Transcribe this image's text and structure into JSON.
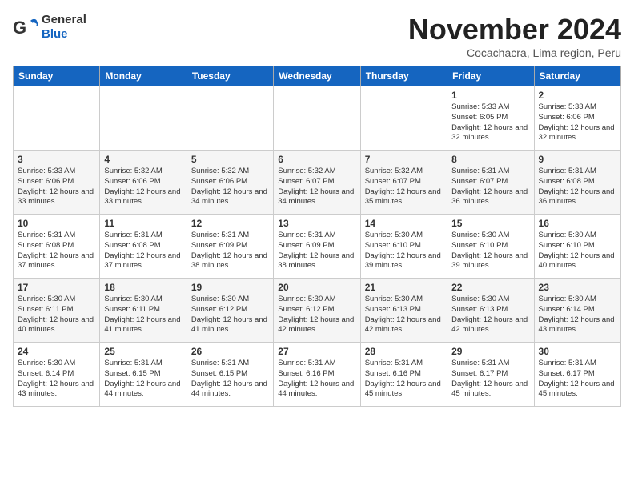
{
  "header": {
    "logo_line1": "General",
    "logo_line2": "Blue",
    "month": "November 2024",
    "location": "Cocachacra, Lima region, Peru"
  },
  "days_of_week": [
    "Sunday",
    "Monday",
    "Tuesday",
    "Wednesday",
    "Thursday",
    "Friday",
    "Saturday"
  ],
  "weeks": [
    [
      {
        "day": "",
        "content": ""
      },
      {
        "day": "",
        "content": ""
      },
      {
        "day": "",
        "content": ""
      },
      {
        "day": "",
        "content": ""
      },
      {
        "day": "",
        "content": ""
      },
      {
        "day": "1",
        "content": "Sunrise: 5:33 AM\nSunset: 6:05 PM\nDaylight: 12 hours and 32 minutes."
      },
      {
        "day": "2",
        "content": "Sunrise: 5:33 AM\nSunset: 6:06 PM\nDaylight: 12 hours and 32 minutes."
      }
    ],
    [
      {
        "day": "3",
        "content": "Sunrise: 5:33 AM\nSunset: 6:06 PM\nDaylight: 12 hours and 33 minutes."
      },
      {
        "day": "4",
        "content": "Sunrise: 5:32 AM\nSunset: 6:06 PM\nDaylight: 12 hours and 33 minutes."
      },
      {
        "day": "5",
        "content": "Sunrise: 5:32 AM\nSunset: 6:06 PM\nDaylight: 12 hours and 34 minutes."
      },
      {
        "day": "6",
        "content": "Sunrise: 5:32 AM\nSunset: 6:07 PM\nDaylight: 12 hours and 34 minutes."
      },
      {
        "day": "7",
        "content": "Sunrise: 5:32 AM\nSunset: 6:07 PM\nDaylight: 12 hours and 35 minutes."
      },
      {
        "day": "8",
        "content": "Sunrise: 5:31 AM\nSunset: 6:07 PM\nDaylight: 12 hours and 36 minutes."
      },
      {
        "day": "9",
        "content": "Sunrise: 5:31 AM\nSunset: 6:08 PM\nDaylight: 12 hours and 36 minutes."
      }
    ],
    [
      {
        "day": "10",
        "content": "Sunrise: 5:31 AM\nSunset: 6:08 PM\nDaylight: 12 hours and 37 minutes."
      },
      {
        "day": "11",
        "content": "Sunrise: 5:31 AM\nSunset: 6:08 PM\nDaylight: 12 hours and 37 minutes."
      },
      {
        "day": "12",
        "content": "Sunrise: 5:31 AM\nSunset: 6:09 PM\nDaylight: 12 hours and 38 minutes."
      },
      {
        "day": "13",
        "content": "Sunrise: 5:31 AM\nSunset: 6:09 PM\nDaylight: 12 hours and 38 minutes."
      },
      {
        "day": "14",
        "content": "Sunrise: 5:30 AM\nSunset: 6:10 PM\nDaylight: 12 hours and 39 minutes."
      },
      {
        "day": "15",
        "content": "Sunrise: 5:30 AM\nSunset: 6:10 PM\nDaylight: 12 hours and 39 minutes."
      },
      {
        "day": "16",
        "content": "Sunrise: 5:30 AM\nSunset: 6:10 PM\nDaylight: 12 hours and 40 minutes."
      }
    ],
    [
      {
        "day": "17",
        "content": "Sunrise: 5:30 AM\nSunset: 6:11 PM\nDaylight: 12 hours and 40 minutes."
      },
      {
        "day": "18",
        "content": "Sunrise: 5:30 AM\nSunset: 6:11 PM\nDaylight: 12 hours and 41 minutes."
      },
      {
        "day": "19",
        "content": "Sunrise: 5:30 AM\nSunset: 6:12 PM\nDaylight: 12 hours and 41 minutes."
      },
      {
        "day": "20",
        "content": "Sunrise: 5:30 AM\nSunset: 6:12 PM\nDaylight: 12 hours and 42 minutes."
      },
      {
        "day": "21",
        "content": "Sunrise: 5:30 AM\nSunset: 6:13 PM\nDaylight: 12 hours and 42 minutes."
      },
      {
        "day": "22",
        "content": "Sunrise: 5:30 AM\nSunset: 6:13 PM\nDaylight: 12 hours and 42 minutes."
      },
      {
        "day": "23",
        "content": "Sunrise: 5:30 AM\nSunset: 6:14 PM\nDaylight: 12 hours and 43 minutes."
      }
    ],
    [
      {
        "day": "24",
        "content": "Sunrise: 5:30 AM\nSunset: 6:14 PM\nDaylight: 12 hours and 43 minutes."
      },
      {
        "day": "25",
        "content": "Sunrise: 5:31 AM\nSunset: 6:15 PM\nDaylight: 12 hours and 44 minutes."
      },
      {
        "day": "26",
        "content": "Sunrise: 5:31 AM\nSunset: 6:15 PM\nDaylight: 12 hours and 44 minutes."
      },
      {
        "day": "27",
        "content": "Sunrise: 5:31 AM\nSunset: 6:16 PM\nDaylight: 12 hours and 44 minutes."
      },
      {
        "day": "28",
        "content": "Sunrise: 5:31 AM\nSunset: 6:16 PM\nDaylight: 12 hours and 45 minutes."
      },
      {
        "day": "29",
        "content": "Sunrise: 5:31 AM\nSunset: 6:17 PM\nDaylight: 12 hours and 45 minutes."
      },
      {
        "day": "30",
        "content": "Sunrise: 5:31 AM\nSunset: 6:17 PM\nDaylight: 12 hours and 45 minutes."
      }
    ]
  ]
}
